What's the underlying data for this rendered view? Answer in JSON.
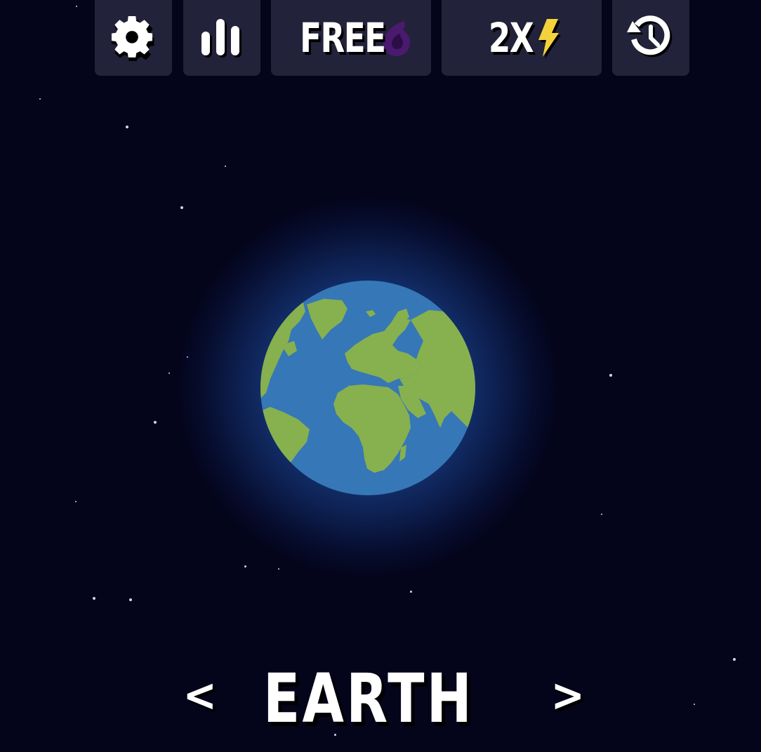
{
  "toolbar": {
    "settings_icon": "gear-icon",
    "stats_icon": "bar-chart-icon",
    "free_label": "FREE",
    "free_icon": "purple-drop-icon",
    "multiplier_label": "2X",
    "multiplier_icon": "lightning-bolt-icon",
    "history_icon": "history-clock-icon"
  },
  "colors": {
    "background": "#04041a",
    "button_bg": "#22223a",
    "ocean": "#3677b7",
    "land": "#87b04f",
    "drop": "#4a1a6e",
    "bolt": "#f4d33a"
  },
  "planet": {
    "name": "EARTH",
    "prev_label": "<",
    "next_label": ">"
  }
}
